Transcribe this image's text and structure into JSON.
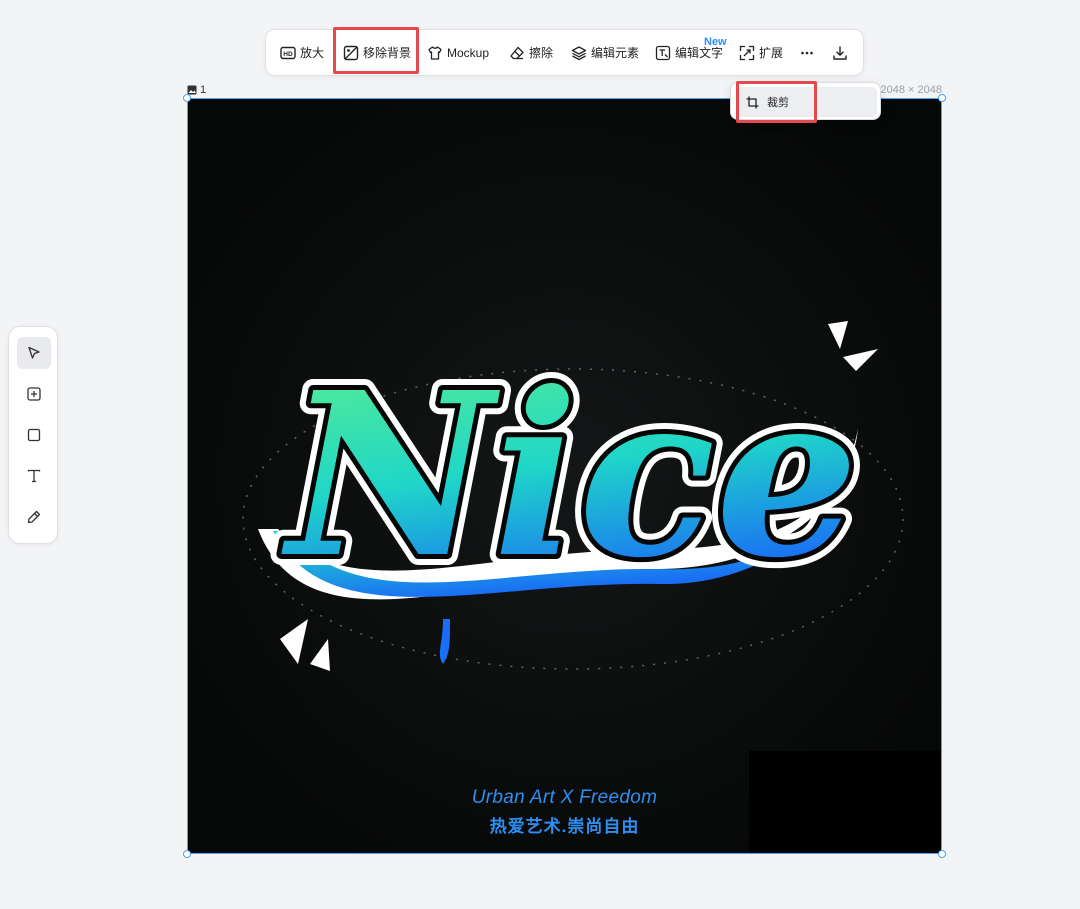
{
  "toolbar": {
    "upscale_label": "放大",
    "remove_bg_label": "移除背景",
    "mockup_label": "Mockup",
    "erase_label": "擦除",
    "edit_elements_label": "编辑元素",
    "edit_text_label": "编辑文字",
    "edit_text_badge": "New",
    "expand_label": "扩展"
  },
  "canvas": {
    "image_index": "1",
    "dimensions": "2048 × 2048",
    "art_title": "Nice",
    "caption_en": "Urban Art X Freedom",
    "caption_zh": "热爱艺术.崇尚自由"
  },
  "dropdown": {
    "crop_label": "裁剪"
  },
  "left_tools": [
    "select",
    "add",
    "rectangle",
    "text",
    "pen"
  ],
  "colors": {
    "highlight": "#e5484d",
    "accent": "#4aa3f5",
    "badge": "#2f8cf5",
    "gradient_top": "#5ef08c",
    "gradient_mid": "#1fd6c8",
    "gradient_bottom": "#1a6ef5"
  }
}
